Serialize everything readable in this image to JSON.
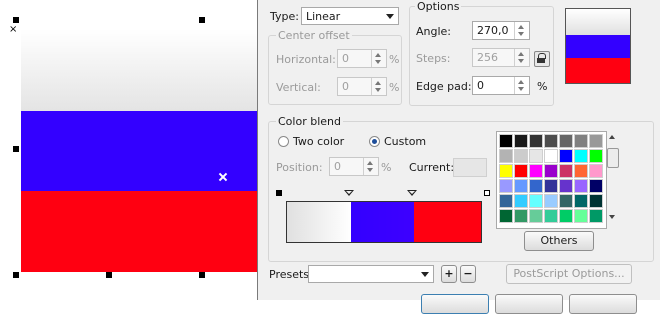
{
  "colors": {
    "preview_bands": [
      "#f2f2f2",
      "#3300ff",
      "#ff0011"
    ],
    "swatch_bands": [
      "#f2f2f2",
      "#3300ff",
      "#ff0011"
    ],
    "palette_rows": [
      [
        "#000000",
        "#1a1a1a",
        "#333333",
        "#4d4d4d",
        "#666666",
        "#808080",
        "#999999"
      ],
      [
        "#b3b3b3",
        "#cccccc",
        "#e6e6e6",
        "#ffffff",
        "#0000ff",
        "#00ffff",
        "#00ff00"
      ],
      [
        "#ffff00",
        "#ff0000",
        "#ff00ff",
        "#9900cc",
        "#cc3366",
        "#ff6633",
        "#ff99cc"
      ],
      [
        "#9999ff",
        "#6699ff",
        "#3366cc",
        "#333399",
        "#6633cc",
        "#9966ff",
        "#000066"
      ],
      [
        "#336699",
        "#33ccff",
        "#66ffff",
        "#99ccff",
        "#336666",
        "#006666",
        "#003333"
      ],
      [
        "#006633",
        "#339966",
        "#66cc99",
        "#33cc99",
        "#00cc66",
        "#66ff99",
        "#009966"
      ]
    ]
  },
  "type": {
    "label": "Type:",
    "value": "Linear"
  },
  "center_offset": {
    "title": "Center offset",
    "horizontal": {
      "label": "Horizontal:",
      "value": "0",
      "unit": "%"
    },
    "vertical": {
      "label": "Vertical:",
      "value": "0",
      "unit": "%"
    }
  },
  "options": {
    "title": "Options",
    "angle": {
      "label": "Angle:",
      "value": "270,0"
    },
    "steps": {
      "label": "Steps:",
      "value": "256"
    },
    "edge_pad": {
      "label": "Edge pad:",
      "value": "0",
      "unit": "%"
    }
  },
  "color_blend": {
    "title": "Color blend",
    "two_color_label": "Two color",
    "custom_label": "Custom",
    "position": {
      "label": "Position:",
      "value": "0",
      "unit": "%"
    },
    "current_label": "Current:"
  },
  "others_button": "Others",
  "presets": {
    "label": "Presets:",
    "value": ""
  },
  "postscript_button": "PostScript Options..."
}
